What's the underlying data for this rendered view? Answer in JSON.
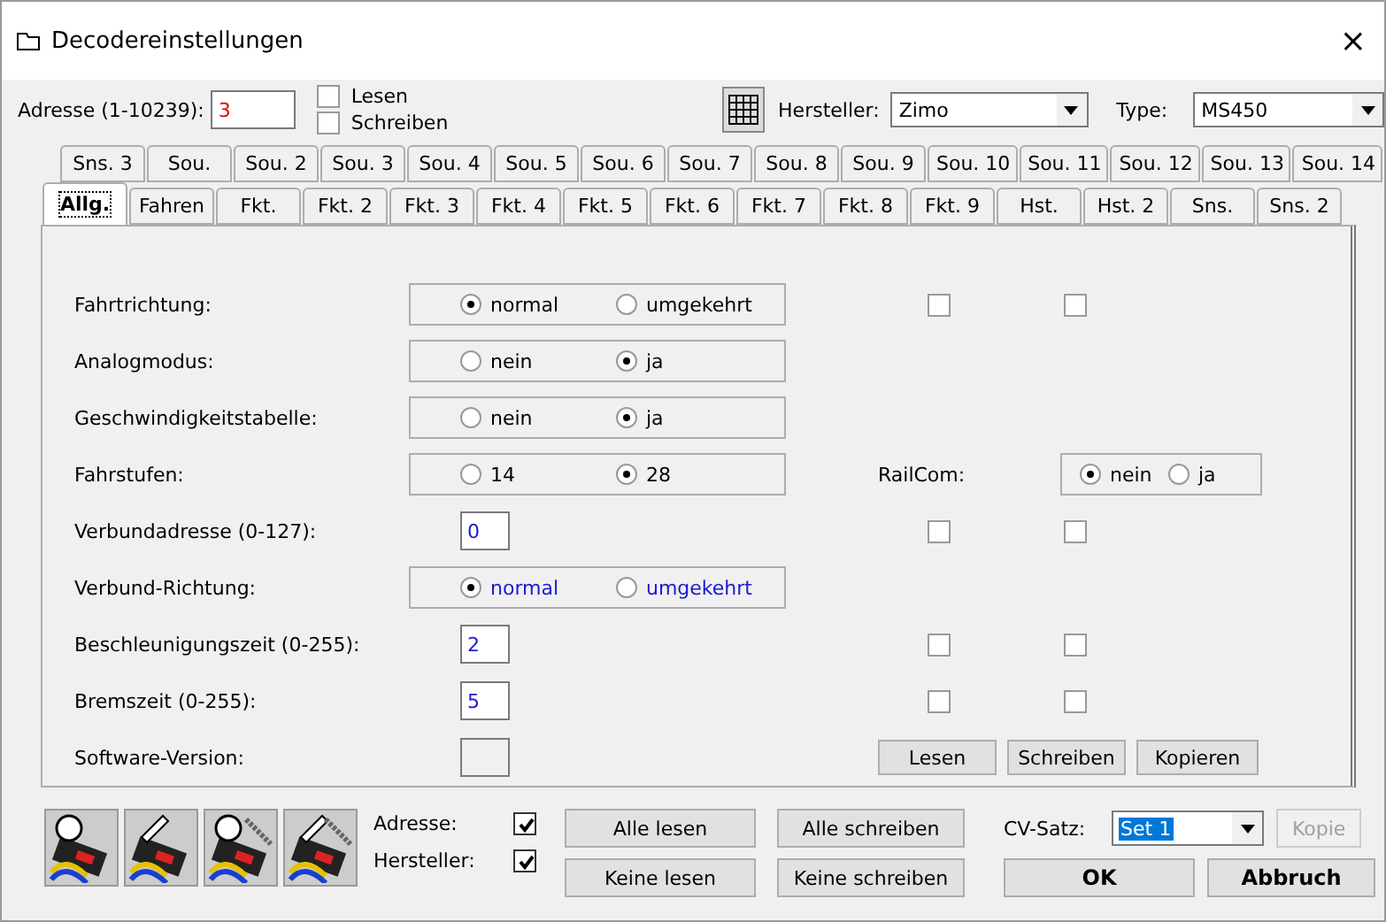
{
  "window": {
    "title": "Decodereinstellungen",
    "close": "×"
  },
  "top": {
    "address_label": "Adresse (1-10239):",
    "address_value": "3",
    "options": [
      {
        "label": "Lesen",
        "checked": false
      },
      {
        "label": "Schreiben",
        "checked": false
      }
    ],
    "maker_label": "Hersteller:",
    "maker_value": "Zimo",
    "type_label": "Type:",
    "type_value": "MS450"
  },
  "tabs_back": [
    {
      "label": "Sns. 3"
    },
    {
      "label": "Sou."
    },
    {
      "label": "Sou. 2"
    },
    {
      "label": "Sou. 3"
    },
    {
      "label": "Sou. 4"
    },
    {
      "label": "Sou. 5"
    },
    {
      "label": "Sou. 6"
    },
    {
      "label": "Sou. 7"
    },
    {
      "label": "Sou. 8"
    },
    {
      "label": "Sou. 9"
    },
    {
      "label": "Sou. 10"
    },
    {
      "label": "Sou. 11"
    },
    {
      "label": "Sou. 12"
    },
    {
      "label": "Sou. 13"
    },
    {
      "label": "Sou. 14"
    }
  ],
  "tabs": [
    {
      "label": "Allg.",
      "selected": true
    },
    {
      "label": "Fahren",
      "selected": false
    },
    {
      "label": "Fkt.",
      "selected": false
    },
    {
      "label": "Fkt. 2",
      "selected": false
    },
    {
      "label": "Fkt. 3",
      "selected": false
    },
    {
      "label": "Fkt. 4",
      "selected": false
    },
    {
      "label": "Fkt. 5",
      "selected": false
    },
    {
      "label": "Fkt. 6",
      "selected": false
    },
    {
      "label": "Fkt. 7",
      "selected": false
    },
    {
      "label": "Fkt. 8",
      "selected": false
    },
    {
      "label": "Fkt. 9",
      "selected": false
    },
    {
      "label": "Hst.",
      "selected": false
    },
    {
      "label": "Hst. 2",
      "selected": false
    },
    {
      "label": "Sns.",
      "selected": false
    },
    {
      "label": "Sns. 2",
      "selected": false
    }
  ],
  "rows": [
    {
      "kind": "radio",
      "label": "Fahrtrichtung:",
      "changed": false,
      "options": [
        {
          "label": "normal",
          "selected": true
        },
        {
          "label": "umgekehrt",
          "selected": false
        }
      ],
      "checks": [
        {
          "checked": false
        },
        {
          "checked": false
        }
      ]
    },
    {
      "kind": "radio",
      "label": "Analogmodus:",
      "changed": false,
      "options": [
        {
          "label": "nein",
          "selected": false
        },
        {
          "label": "ja",
          "selected": true
        }
      ]
    },
    {
      "kind": "radio",
      "label": "Geschwindigkeitstabelle:",
      "changed": false,
      "options": [
        {
          "label": "nein",
          "selected": false
        },
        {
          "label": "ja",
          "selected": true
        }
      ]
    },
    {
      "kind": "radio",
      "label": "Fahrstufen:",
      "changed": false,
      "options": [
        {
          "label": "14",
          "selected": false
        },
        {
          "label": "28",
          "selected": true
        }
      ],
      "railcom": {
        "label": "RailCom:",
        "options": [
          {
            "label": "nein",
            "selected": true
          },
          {
            "label": "ja",
            "selected": false
          }
        ]
      }
    },
    {
      "kind": "input",
      "label": "Verbundadresse (0-127):",
      "value": "0",
      "checks": [
        {
          "checked": false
        },
        {
          "checked": false
        }
      ]
    },
    {
      "kind": "radio",
      "label": "Verbund-Richtung:",
      "changed": true,
      "options": [
        {
          "label": "normal",
          "selected": true
        },
        {
          "label": "umgekehrt",
          "selected": false
        }
      ]
    },
    {
      "kind": "input",
      "label": "Beschleunigungszeit (0-255):",
      "value": "2",
      "checks": [
        {
          "checked": false
        },
        {
          "checked": false
        }
      ]
    },
    {
      "kind": "input",
      "label": "Bremszeit (0-255):",
      "value": "5",
      "checks": [
        {
          "checked": false
        },
        {
          "checked": false
        }
      ]
    },
    {
      "kind": "readonly",
      "label": "Software-Version:",
      "value": ""
    }
  ],
  "panel_buttons": [
    "Lesen",
    "Schreiben",
    "Kopieren"
  ],
  "bottom": {
    "flags": [
      {
        "label": "Adresse:",
        "checked": true
      },
      {
        "label": "Hersteller:",
        "checked": true
      }
    ],
    "read_buttons": [
      "Alle lesen",
      "Keine lesen"
    ],
    "write_buttons": [
      "Alle schreiben",
      "Keine schreiben"
    ],
    "cv_label": "CV-Satz:",
    "cv_value": "Set 1",
    "copy": {
      "label": "Kopie",
      "disabled": true
    },
    "ok": "OK",
    "cancel": "Abbruch"
  }
}
